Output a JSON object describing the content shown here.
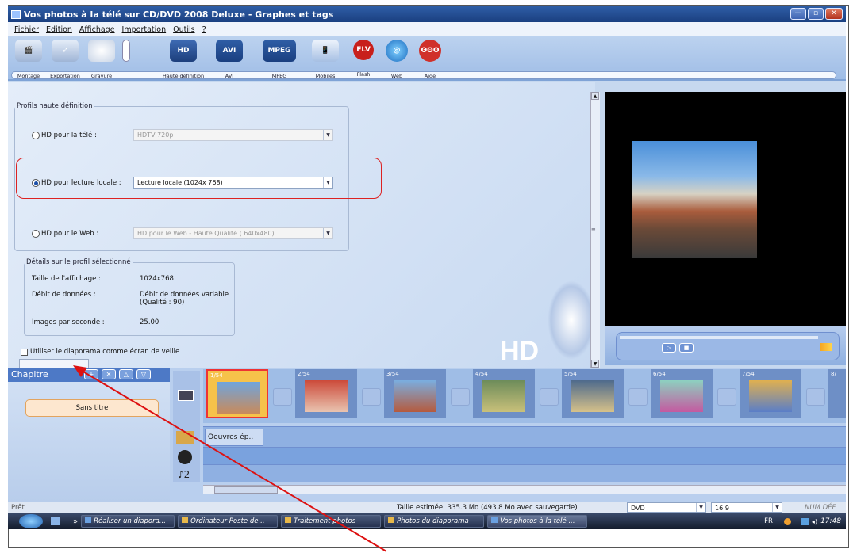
{
  "window": {
    "title": "Vos photos à la télé sur CD/DVD 2008 Deluxe - Graphes et tags"
  },
  "menu": [
    "Fichier",
    "Edition",
    "Affichage",
    "Importation",
    "Outils",
    "?"
  ],
  "toolbar": {
    "group1": [
      "Montage",
      "Exportation",
      "Gravure"
    ],
    "group2": [
      "Haute définition",
      "AVI",
      "MPEG",
      "Mobiles",
      "Flash",
      "Web",
      "Aide"
    ],
    "icon_text": {
      "hd": "HD",
      "avi": "AVI",
      "mpeg": "MPEG",
      "flv": "FLV"
    }
  },
  "hd_profiles": {
    "legend": "Profils haute définition",
    "tv": {
      "label": "HD pour la télé :",
      "value": "HDTV 720p"
    },
    "local": {
      "label": "HD pour lecture locale :",
      "value": "Lecture locale (1024x 768)"
    },
    "web": {
      "label": "HD pour le Web :",
      "value": "HD pour le Web - Haute Qualité ( 640x480)"
    }
  },
  "details": {
    "legend": "Détails sur le profil sélectionné",
    "size_label": "Taille de l'affichage :",
    "size_value": "1024x768",
    "rate_label": "Débit de données :",
    "rate_value": "Débit de données variable",
    "rate_value2": "(Qualité : 90)",
    "fps_label": "Images par seconde :",
    "fps_value": "25.00"
  },
  "screensaver_label": "Utiliser le diaporama comme écran de veille",
  "hd_watermark": "HD",
  "chapters": {
    "header": "Chapitre",
    "item": "Sans titre"
  },
  "slides": [
    "1/54",
    "2/54",
    "3/54",
    "4/54",
    "5/54",
    "6/54",
    "7/54",
    "8/"
  ],
  "track1_label": "Oeuvres ép..",
  "status": {
    "left": "Prêt",
    "estimate": "Taille estimée: 335.3 Mo  (493.8 Mo avec sauvegarde)",
    "format": "DVD",
    "ratio": "16:9",
    "num": "NUM  DÉF"
  },
  "taskbar": {
    "items": [
      "Réaliser un diapora...",
      "Ordinateur Poste de...",
      "Traitement photos",
      "Photos du diaporama",
      "Vos photos à la télé ..."
    ],
    "lang": "FR",
    "time": "17:48"
  },
  "colors": {
    "accent": "#4d79c6",
    "highlight": "#dd2222",
    "arrow": "#dd1111"
  }
}
